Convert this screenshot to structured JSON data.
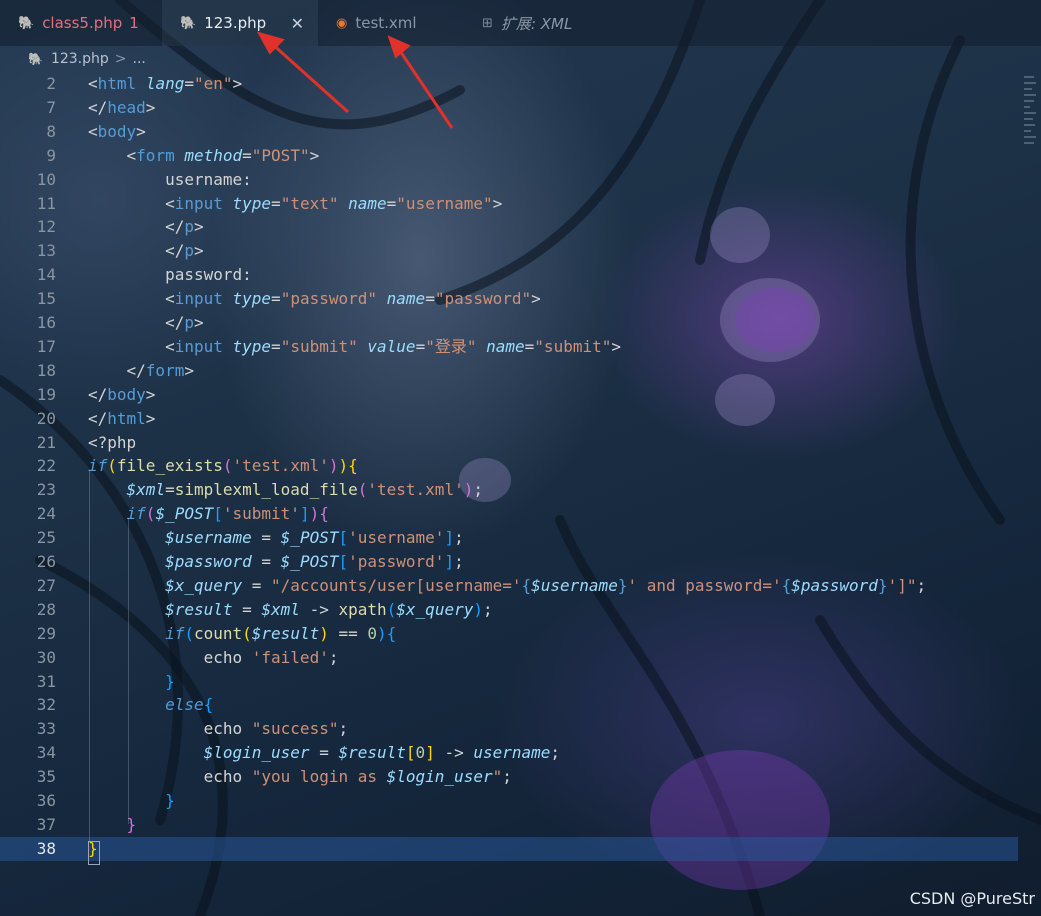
{
  "tabs": [
    {
      "label": "class5.php",
      "badge": "1",
      "icon": "php-elephant-icon"
    },
    {
      "label": "123.php",
      "close": "✕",
      "icon": "php-elephant-icon"
    },
    {
      "label": "test.xml",
      "icon": "rss-icon"
    },
    {
      "label": "扩展: XML",
      "icon": "extensions-icon"
    }
  ],
  "breadcrumb": {
    "file": "123.php",
    "separator": ">",
    "more": "..."
  },
  "code_lines": [
    {
      "n": "2"
    },
    {
      "n": "7"
    },
    {
      "n": "8"
    },
    {
      "n": "9"
    },
    {
      "n": "10"
    },
    {
      "n": "11"
    },
    {
      "n": "12"
    },
    {
      "n": "13"
    },
    {
      "n": "14"
    },
    {
      "n": "15"
    },
    {
      "n": "16"
    },
    {
      "n": "17"
    },
    {
      "n": "18"
    },
    {
      "n": "19"
    },
    {
      "n": "20"
    },
    {
      "n": "21"
    },
    {
      "n": "22"
    },
    {
      "n": "23"
    },
    {
      "n": "24"
    },
    {
      "n": "25"
    },
    {
      "n": "26"
    },
    {
      "n": "27"
    },
    {
      "n": "28"
    },
    {
      "n": "29"
    },
    {
      "n": "30"
    },
    {
      "n": "31"
    },
    {
      "n": "32"
    },
    {
      "n": "33"
    },
    {
      "n": "34"
    },
    {
      "n": "35"
    },
    {
      "n": "36"
    },
    {
      "n": "37"
    },
    {
      "n": "38"
    }
  ],
  "code_tokens": [
    [
      [
        "<",
        "pl"
      ],
      [
        "html",
        "tg"
      ],
      [
        " ",
        "pl"
      ],
      [
        "lang",
        "at"
      ],
      [
        "=",
        "pl"
      ],
      [
        "\"en\"",
        "st"
      ],
      [
        ">",
        "pl"
      ]
    ],
    [
      [
        "</",
        "pl"
      ],
      [
        "head",
        "tg"
      ],
      [
        ">",
        "pl"
      ]
    ],
    [
      [
        "<",
        "pl"
      ],
      [
        "body",
        "tg"
      ],
      [
        ">",
        "pl"
      ]
    ],
    [
      [
        "    <",
        "pl"
      ],
      [
        "form",
        "tg"
      ],
      [
        " ",
        "pl"
      ],
      [
        "method",
        "at"
      ],
      [
        "=",
        "pl"
      ],
      [
        "\"POST\"",
        "st"
      ],
      [
        ">",
        "pl"
      ]
    ],
    [
      [
        "        username:",
        "pl"
      ]
    ],
    [
      [
        "        <",
        "pl"
      ],
      [
        "input",
        "tg"
      ],
      [
        " ",
        "pl"
      ],
      [
        "type",
        "at"
      ],
      [
        "=",
        "pl"
      ],
      [
        "\"text\"",
        "st"
      ],
      [
        " ",
        "pl"
      ],
      [
        "name",
        "at"
      ],
      [
        "=",
        "pl"
      ],
      [
        "\"username\"",
        "st"
      ],
      [
        ">",
        "pl"
      ]
    ],
    [
      [
        "        </",
        "pl"
      ],
      [
        "p",
        "tg"
      ],
      [
        ">",
        "pl"
      ]
    ],
    [
      [
        "        </",
        "pl"
      ],
      [
        "p",
        "tg"
      ],
      [
        ">",
        "pl"
      ]
    ],
    [
      [
        "        password:",
        "pl"
      ]
    ],
    [
      [
        "        <",
        "pl"
      ],
      [
        "input",
        "tg"
      ],
      [
        " ",
        "pl"
      ],
      [
        "type",
        "at"
      ],
      [
        "=",
        "pl"
      ],
      [
        "\"password\"",
        "st"
      ],
      [
        " ",
        "pl"
      ],
      [
        "name",
        "at"
      ],
      [
        "=",
        "pl"
      ],
      [
        "\"password\"",
        "st"
      ],
      [
        ">",
        "pl"
      ]
    ],
    [
      [
        "        </",
        "pl"
      ],
      [
        "p",
        "tg"
      ],
      [
        ">",
        "pl"
      ]
    ],
    [
      [
        "        <",
        "pl"
      ],
      [
        "input",
        "tg"
      ],
      [
        " ",
        "pl"
      ],
      [
        "type",
        "at"
      ],
      [
        "=",
        "pl"
      ],
      [
        "\"submit\"",
        "st"
      ],
      [
        " ",
        "pl"
      ],
      [
        "value",
        "at"
      ],
      [
        "=",
        "pl"
      ],
      [
        "\"登录\"",
        "st"
      ],
      [
        " ",
        "pl"
      ],
      [
        "name",
        "at"
      ],
      [
        "=",
        "pl"
      ],
      [
        "\"submit\"",
        "st"
      ],
      [
        ">",
        "pl"
      ]
    ],
    [
      [
        "    </",
        "pl"
      ],
      [
        "form",
        "tg"
      ],
      [
        ">",
        "pl"
      ]
    ],
    [
      [
        "</",
        "pl"
      ],
      [
        "body",
        "tg"
      ],
      [
        ">",
        "pl"
      ]
    ],
    [
      [
        "</",
        "pl"
      ],
      [
        "html",
        "tg"
      ],
      [
        ">",
        "pl"
      ]
    ],
    [
      [
        "<?php",
        "pl"
      ]
    ],
    [
      [
        "if",
        "kw"
      ],
      [
        "(",
        "b1"
      ],
      [
        "file_exists",
        "fn"
      ],
      [
        "(",
        "b2"
      ],
      [
        "'test.xml'",
        "st"
      ],
      [
        ")",
        "b2"
      ],
      [
        ")",
        "b1"
      ],
      [
        "{",
        "b1"
      ]
    ],
    [
      [
        "    ",
        "pl"
      ],
      [
        "$xml",
        "vr"
      ],
      [
        "=",
        "pl"
      ],
      [
        "simplexml_load_file",
        "fn"
      ],
      [
        "(",
        "b2"
      ],
      [
        "'test.xml'",
        "st"
      ],
      [
        ")",
        "b2"
      ],
      [
        ";",
        "pl"
      ]
    ],
    [
      [
        "    ",
        "pl"
      ],
      [
        "if",
        "kw"
      ],
      [
        "(",
        "b2"
      ],
      [
        "$_POST",
        "vr"
      ],
      [
        "[",
        "b3"
      ],
      [
        "'submit'",
        "st"
      ],
      [
        "]",
        "b3"
      ],
      [
        ")",
        "b2"
      ],
      [
        "{",
        "b2"
      ]
    ],
    [
      [
        "        ",
        "pl"
      ],
      [
        "$username",
        "vr"
      ],
      [
        " = ",
        "pl"
      ],
      [
        "$_POST",
        "vr"
      ],
      [
        "[",
        "b3"
      ],
      [
        "'username'",
        "st"
      ],
      [
        "]",
        "b3"
      ],
      [
        ";",
        "pl"
      ]
    ],
    [
      [
        "        ",
        "pl"
      ],
      [
        "$password",
        "vr"
      ],
      [
        " = ",
        "pl"
      ],
      [
        "$_POST",
        "vr"
      ],
      [
        "[",
        "b3"
      ],
      [
        "'password'",
        "st"
      ],
      [
        "]",
        "b3"
      ],
      [
        ";",
        "pl"
      ]
    ],
    [
      [
        "        ",
        "pl"
      ],
      [
        "$x_query",
        "vr"
      ],
      [
        " = ",
        "pl"
      ],
      [
        "\"/accounts/user[username='",
        "st"
      ],
      [
        "{",
        "pv"
      ],
      [
        "$username",
        "vr"
      ],
      [
        "}",
        "pv"
      ],
      [
        "' and password='",
        "st"
      ],
      [
        "{",
        "pv"
      ],
      [
        "$password",
        "vr"
      ],
      [
        "}",
        "pv"
      ],
      [
        "']\"",
        "st"
      ],
      [
        ";",
        "pl"
      ]
    ],
    [
      [
        "        ",
        "pl"
      ],
      [
        "$result",
        "vr"
      ],
      [
        " = ",
        "pl"
      ],
      [
        "$xml",
        "vr"
      ],
      [
        " -> ",
        "pl"
      ],
      [
        "xpath",
        "fn"
      ],
      [
        "(",
        "b3"
      ],
      [
        "$x_query",
        "vr"
      ],
      [
        ")",
        "b3"
      ],
      [
        ";",
        "pl"
      ]
    ],
    [
      [
        "        ",
        "pl"
      ],
      [
        "if",
        "kw"
      ],
      [
        "(",
        "b3"
      ],
      [
        "count",
        "fn"
      ],
      [
        "(",
        "b1"
      ],
      [
        "$result",
        "vr"
      ],
      [
        ")",
        "b1"
      ],
      [
        " == ",
        "pl"
      ],
      [
        "0",
        "nm"
      ],
      [
        ")",
        "b3"
      ],
      [
        "{",
        "b3"
      ]
    ],
    [
      [
        "            echo ",
        "pl"
      ],
      [
        "'failed'",
        "st"
      ],
      [
        ";",
        "pl"
      ]
    ],
    [
      [
        "        ",
        "pl"
      ],
      [
        "}",
        "b3"
      ]
    ],
    [
      [
        "        ",
        "pl"
      ],
      [
        "else",
        "kw"
      ],
      [
        "{",
        "b3"
      ]
    ],
    [
      [
        "            echo ",
        "pl"
      ],
      [
        "\"success\"",
        "st"
      ],
      [
        ";",
        "pl"
      ]
    ],
    [
      [
        "            ",
        "pl"
      ],
      [
        "$login_user",
        "vr"
      ],
      [
        " = ",
        "pl"
      ],
      [
        "$result",
        "vr"
      ],
      [
        "[",
        "b1"
      ],
      [
        "0",
        "nm"
      ],
      [
        "]",
        "b1"
      ],
      [
        " -> ",
        "pl"
      ],
      [
        "username",
        "vr"
      ],
      [
        ";",
        "pl"
      ]
    ],
    [
      [
        "            echo ",
        "pl"
      ],
      [
        "\"you login as ",
        "st"
      ],
      [
        "$login_user",
        "vr"
      ],
      [
        "\"",
        "st"
      ],
      [
        ";",
        "pl"
      ]
    ],
    [
      [
        "        ",
        "pl"
      ],
      [
        "}",
        "b3"
      ]
    ],
    [
      [
        "    ",
        "pl"
      ],
      [
        "}",
        "b2"
      ]
    ],
    [
      [
        "}",
        "b1"
      ]
    ]
  ],
  "watermark": "CSDN @PureStr"
}
